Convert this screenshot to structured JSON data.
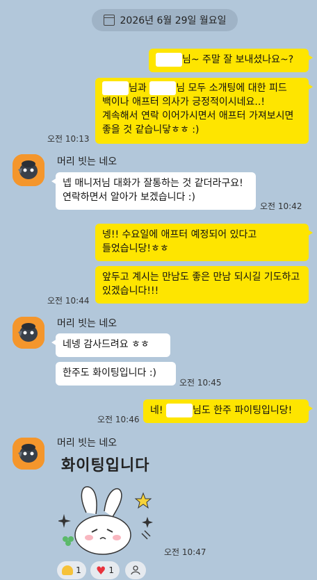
{
  "date": "2026년 6월 29일 월요일",
  "sender_name": "머리 빗는 네오",
  "messages": {
    "m1_text": "님~ 주말 잘 보내셨나요~?",
    "m2_line1_a": "님과",
    "m2_line1_b": "님 모두 소개팅에 대한 피드",
    "m2_rest": "백이나 애프터 의사가 긍정적이시네요..! 계속해서 연락 이어가시면서 애프터 가져보시면 좋을 것 같습니닿ㅎㅎ :)",
    "m2_time": "오전 10:13",
    "o1_text": "넵 매니저님 대화가 잘통하는 것 같더라구요! 연락하면서 알아가 보겠습니다 :)",
    "o1_time": "오전 10:42",
    "m3_text": "넹!! 수요일에 애프터 예정되어 있다고 들었습니당!ㅎㅎ",
    "m4_text": "앞두고 계시는 만남도 좋은 만남 되시길 기도하고 있겠습니다!!!",
    "m4_time": "오전 10:44",
    "o2_text": "네넹 감사드려요 ㅎㅎ",
    "o3_text": "한주도 화이팅입니다 :)",
    "o3_time": "오전 10:45",
    "m5_a": "네!",
    "m5_b": "님도 한주 파이팅입니당!",
    "m5_time": "오전 10:46",
    "sticker_text": "화이팅입니다",
    "sticker_time": "오전 10:47"
  },
  "reactions": [
    {
      "icon": "muscle-icon",
      "count": "1"
    },
    {
      "icon": "heart-icon",
      "count": "1"
    },
    {
      "icon": "person-icon",
      "count": ""
    }
  ],
  "colors": {
    "background": "#b2c7da",
    "my_bubble": "#fee500",
    "other_bubble": "#ffffff",
    "avatar": "#f4962c"
  }
}
